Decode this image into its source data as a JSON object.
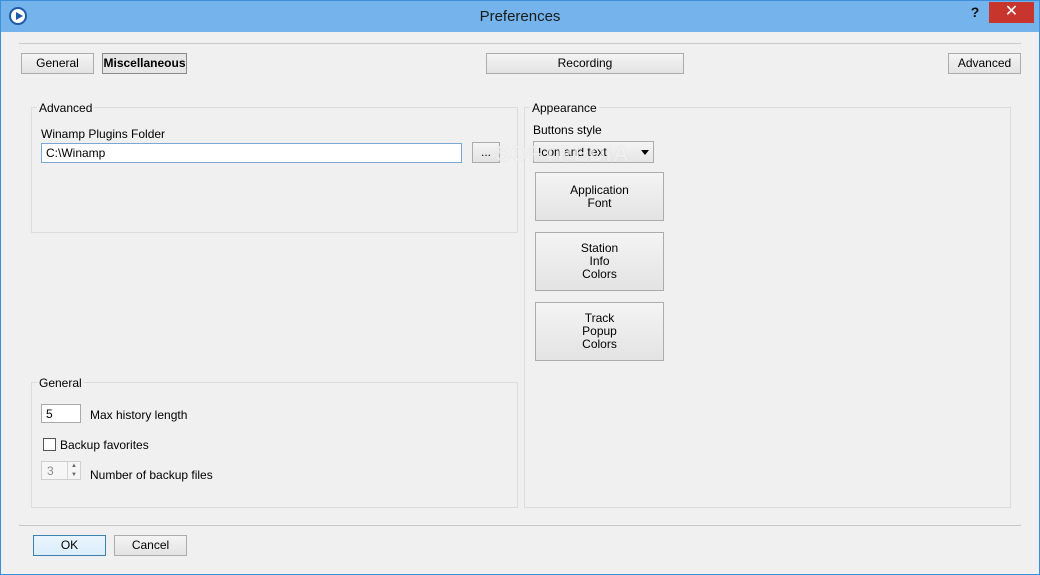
{
  "window": {
    "title": "Preferences",
    "help": "?",
    "close": "✕"
  },
  "tabs": {
    "general": "General",
    "miscellaneous": "Miscellaneous",
    "recording": "Recording",
    "advanced": "Advanced",
    "active": "Miscellaneous"
  },
  "advanced_group": {
    "title": "Advanced",
    "plugins_label": "Winamp Plugins Folder",
    "plugins_value": "C:\\Winamp",
    "browse": "..."
  },
  "general_group": {
    "title": "General",
    "max_history_value": "5",
    "max_history_label": "Max history length",
    "backup_favorites_label": "Backup favorites",
    "backup_favorites_checked": false,
    "backup_files_value": "3",
    "backup_files_label": "Number of backup files"
  },
  "appearance_group": {
    "title": "Appearance",
    "buttons_style_label": "Buttons style",
    "buttons_style_value": "Icon and text",
    "application_font_line1": "Application",
    "application_font_line2": "Font",
    "station_info_line1": "Station",
    "station_info_line2": "Info",
    "station_info_line3": "Colors",
    "track_popup_line1": "Track",
    "track_popup_line2": "Popup",
    "track_popup_line3": "Colors"
  },
  "footer": {
    "ok": "OK",
    "cancel": "Cancel"
  },
  "watermark": "SOFTPEDIA",
  "colors": {
    "titlebar": "#74b3ec",
    "close": "#c7352c",
    "ok_border": "#3c7fb1"
  }
}
